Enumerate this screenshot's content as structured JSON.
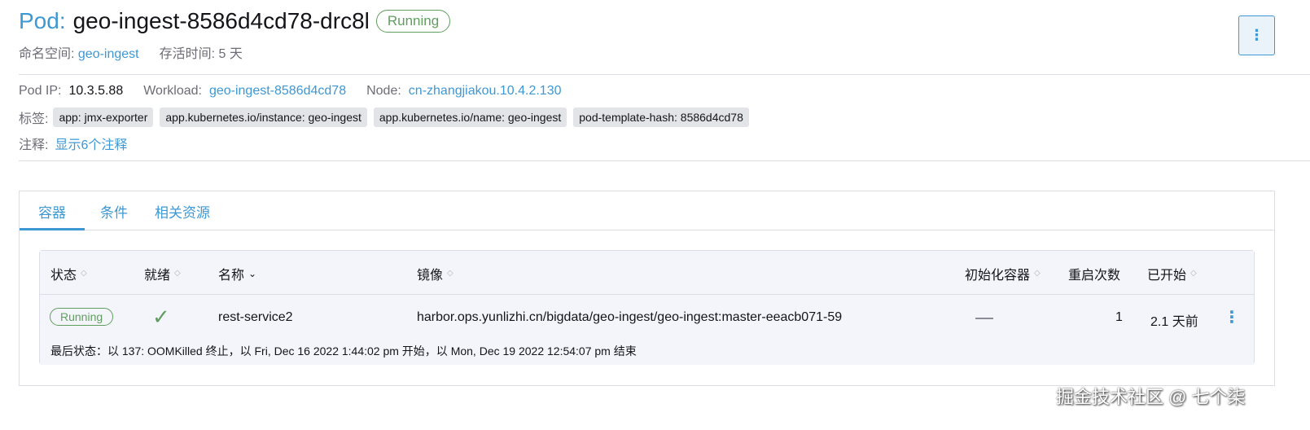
{
  "header": {
    "kind": "Pod:",
    "name": "geo-ingest-8586d4cd78-drc8l",
    "status": "Running",
    "namespace_label": "命名空间:",
    "namespace_value": "geo-ingest",
    "age_label": "存活时间:",
    "age_value": "5 天",
    "menu_icon": "⋮"
  },
  "info": {
    "pod_ip_label": "Pod IP:",
    "pod_ip_value": "10.3.5.88",
    "workload_label": "Workload:",
    "workload_value": "geo-ingest-8586d4cd78",
    "node_label": "Node:",
    "node_value": "cn-zhangjiakou.10.4.2.130"
  },
  "labels": {
    "label": "标签:",
    "tags": [
      "app: jmx-exporter",
      "app.kubernetes.io/instance: geo-ingest",
      "app.kubernetes.io/name: geo-ingest",
      "pod-template-hash: 8586d4cd78"
    ]
  },
  "annotations": {
    "label": "注释:",
    "link": "显示6个注释"
  },
  "tabs": [
    {
      "label": "容器"
    },
    {
      "label": "条件"
    },
    {
      "label": "相关资源"
    }
  ],
  "table": {
    "headers": {
      "status": "状态",
      "ready": "就绪",
      "name": "名称",
      "image": "镜像",
      "init": "初始化容器",
      "restarts": "重启次数",
      "started": "已开始"
    },
    "rows": [
      {
        "status": "Running",
        "ready": "✓",
        "name": "rest-service2",
        "image": "harbor.ops.yunlizhi.cn/bigdata/geo-ingest/geo-ingest:master-eeacb071-59",
        "restarts": "1",
        "started": "2.1 天前",
        "last_state": "最后状态：以 137: OOMKilled 终止，以 Fri, Dec 16 2022 1:44:02 pm 开始，以 Mon, Dec 19 2022 12:54:07 pm 结束"
      }
    ]
  },
  "watermark": "掘金技术社区 @ 七个柒",
  "colors": {
    "accent": "#3d98d3",
    "success": "#5f9e5f",
    "muted": "#6c6c76",
    "border": "#dcdee7"
  }
}
